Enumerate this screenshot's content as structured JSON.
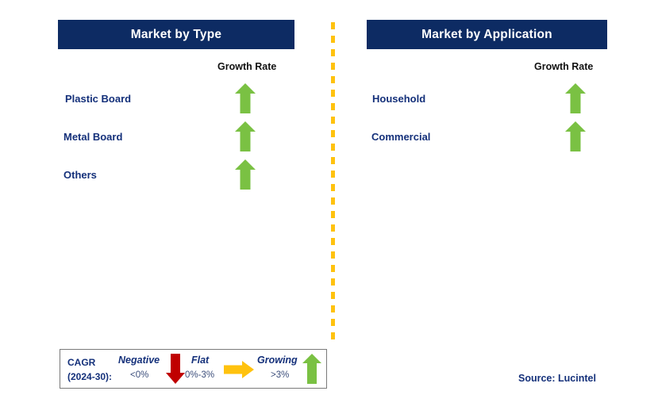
{
  "panels": [
    {
      "name": "market-by-type",
      "title": "Market by Type",
      "growth_caption": "Growth Rate",
      "rows": [
        {
          "label": "Plastic Board",
          "trend": "growing",
          "icon": "arrow-up-icon"
        },
        {
          "label": "Metal Board",
          "trend": "growing",
          "icon": "arrow-up-icon"
        },
        {
          "label": "Others",
          "trend": "growing",
          "icon": "arrow-up-icon"
        }
      ]
    },
    {
      "name": "market-by-application",
      "title": "Market by Application",
      "growth_caption": "Growth Rate",
      "rows": [
        {
          "label": "Household",
          "trend": "growing",
          "icon": "arrow-up-icon"
        },
        {
          "label": "Commercial",
          "trend": "growing",
          "icon": "arrow-up-icon"
        }
      ]
    }
  ],
  "legend": {
    "cagr_line1": "CAGR",
    "cagr_line2": "(2024-30):",
    "items": [
      {
        "term": "Negative",
        "range": "<0%",
        "icon": "arrow-down-icon",
        "color": "#c00000"
      },
      {
        "term": "Flat",
        "range": "0%-3%",
        "icon": "arrow-right-icon",
        "color": "#ffc20e"
      },
      {
        "term": "Growing",
        "range": ">3%",
        "icon": "arrow-up-icon",
        "color": "#7ac143"
      }
    ]
  },
  "source": "Source: Lucintel",
  "colors": {
    "header_bar": "#0d2b63",
    "label_text": "#14307a",
    "growing_arrow": "#7ac143",
    "negative_arrow": "#c00000",
    "flat_arrow": "#ffc20e",
    "divider_dash": "#ffc20e"
  }
}
